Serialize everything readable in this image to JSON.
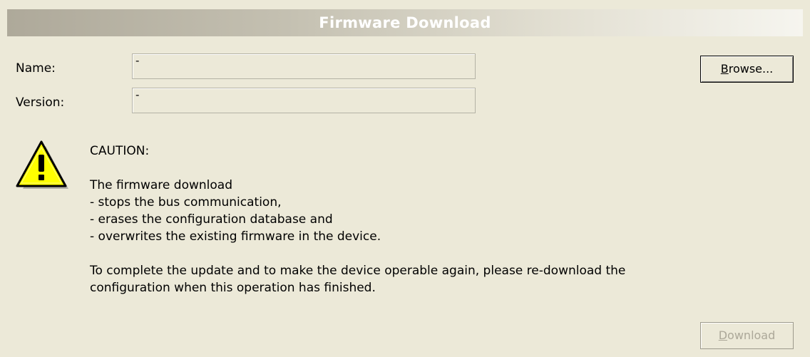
{
  "header": {
    "title": "Firmware Download"
  },
  "form": {
    "name_label": "Name:",
    "name_value": "-",
    "version_label": "Version:",
    "version_value": "-"
  },
  "buttons": {
    "browse_prefix": "B",
    "browse_rest": "rowse...",
    "download_prefix": "D",
    "download_rest": "ownload"
  },
  "warning": {
    "icon": "warning-triangle-icon",
    "caution_heading": "CAUTION:",
    "intro": "The firmware download",
    "items": [
      "- stops the bus communication,",
      "- erases the configuration database and",
      "- overwrites the existing firmware in the device."
    ],
    "note_lines": [
      "To complete the update and to make the device operable again, please re-download the",
      "configuration when this operation has finished."
    ]
  },
  "colors": {
    "background": "#ece9d8",
    "header_text": "#ffffff",
    "warning_yellow": "#ffff00",
    "disabled_text": "#aca899"
  }
}
